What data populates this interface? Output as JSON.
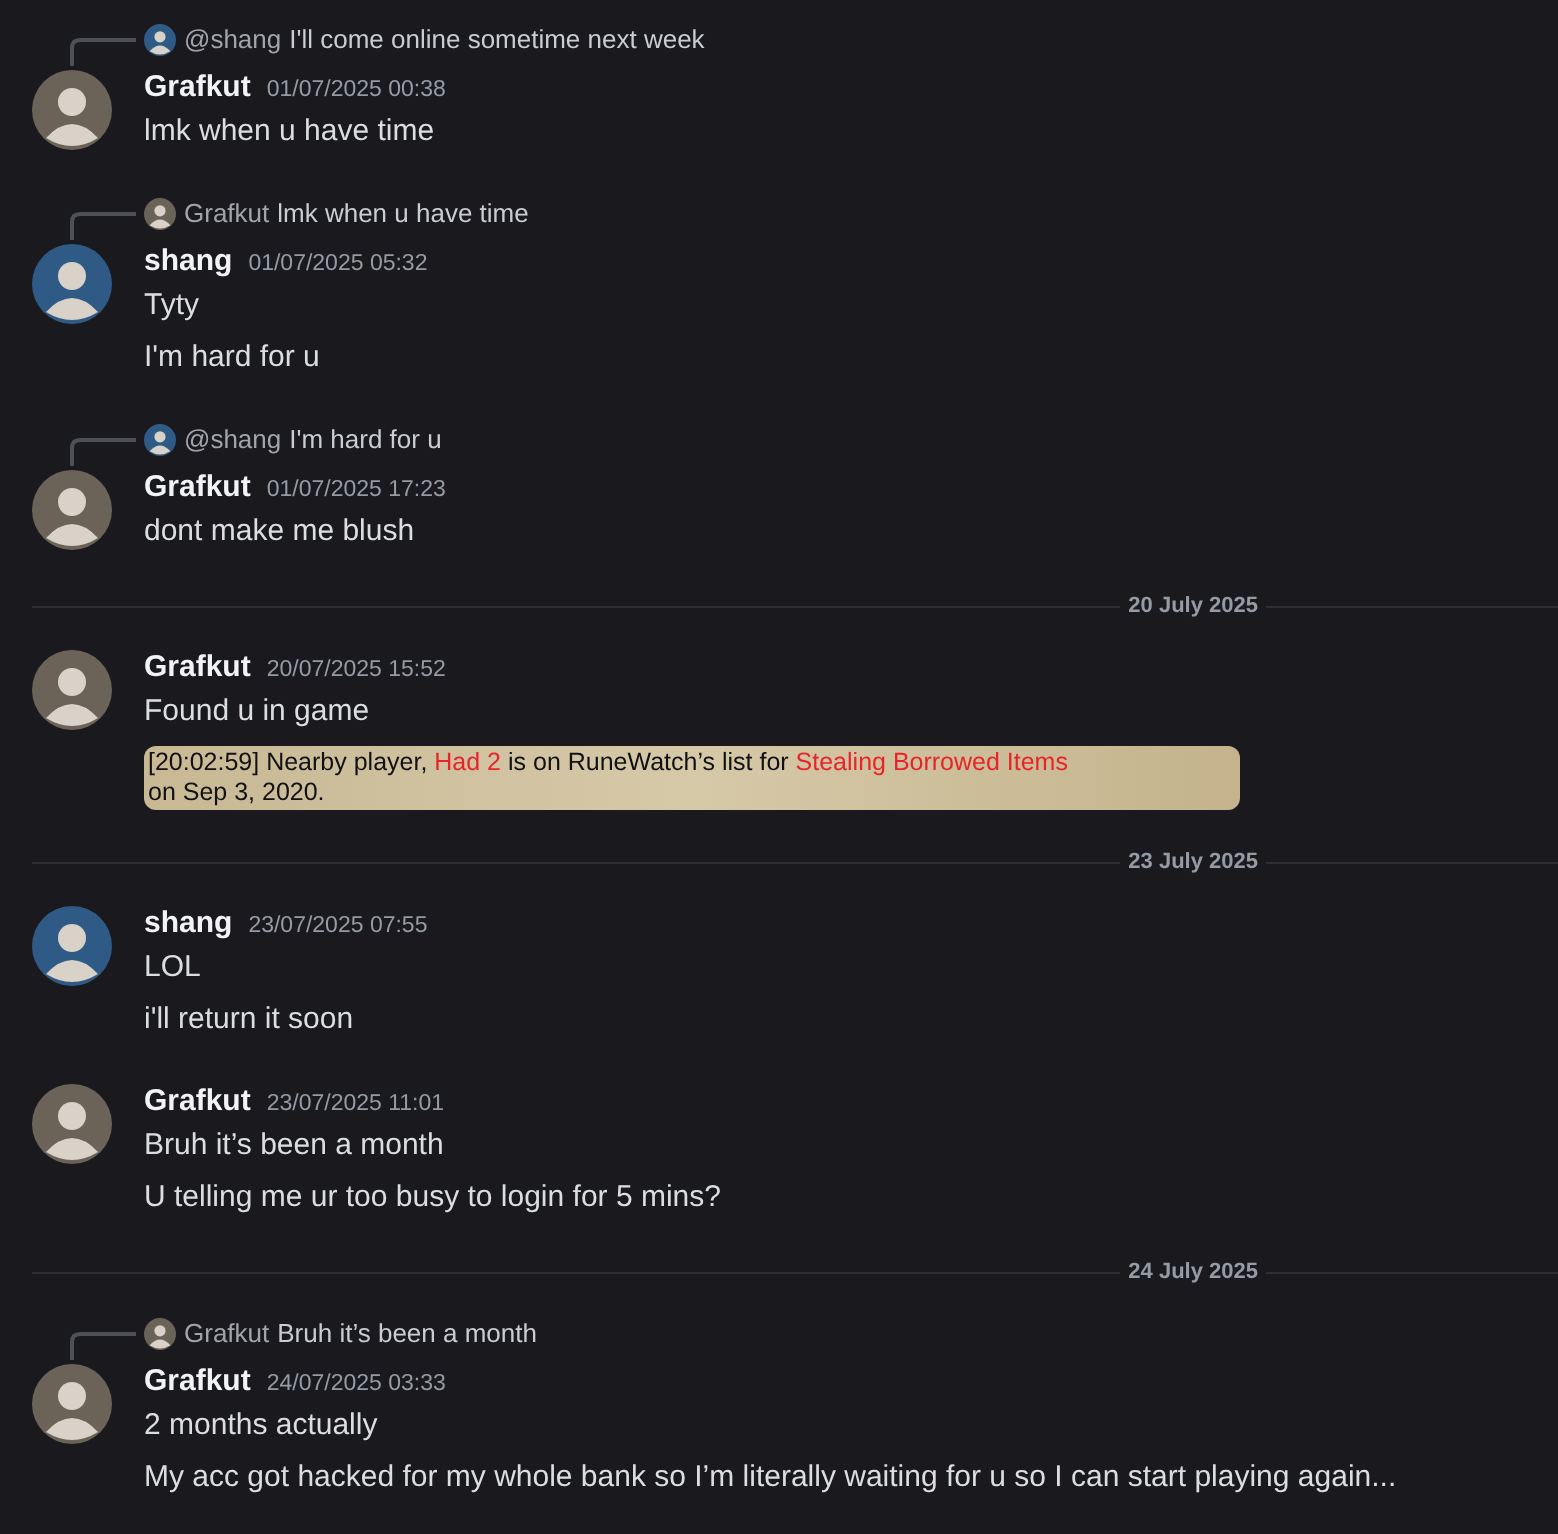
{
  "items": [
    {
      "kind": "message",
      "color": "#6b6358",
      "reply": {
        "color": "#2f5a86",
        "author": "@shang",
        "text": "I'll come online sometime next week"
      },
      "author": "Grafkut",
      "timestamp": "01/07/2025 00:38",
      "lines": [
        "lmk when u have time"
      ]
    },
    {
      "kind": "message",
      "color": "#2f5a86",
      "reply": {
        "color": "#6b6358",
        "author": "Grafkut",
        "text": "lmk when u have time"
      },
      "author": "shang",
      "timestamp": "01/07/2025 05:32",
      "lines": [
        "Tyty",
        "I'm hard for u"
      ]
    },
    {
      "kind": "message",
      "color": "#6b6358",
      "reply": {
        "color": "#2f5a86",
        "author": "@shang",
        "text": "I'm hard for u"
      },
      "author": "Grafkut",
      "timestamp": "01/07/2025 17:23",
      "lines": [
        "dont make me blush"
      ]
    },
    {
      "kind": "divider",
      "label": "20 July 2025"
    },
    {
      "kind": "message",
      "color": "#6b6358",
      "author": "Grafkut",
      "timestamp": "20/07/2025 15:52",
      "lines": [
        "Found u in game"
      ],
      "game_chat": [
        {
          "text": "[20:02:59] Nearby player, ",
          "highlight": false
        },
        {
          "text": "Had 2",
          "highlight": true
        },
        {
          "text": " is on RuneWatch’s list for ",
          "highlight": false
        },
        {
          "text": "Stealing Borrowed Items",
          "highlight": true
        },
        {
          "text": " on Sep 3, 2020.",
          "highlight": false
        }
      ]
    },
    {
      "kind": "divider",
      "label": "23 July 2025"
    },
    {
      "kind": "message",
      "color": "#2f5a86",
      "author": "shang",
      "timestamp": "23/07/2025 07:55",
      "lines": [
        "LOL",
        "i'll return it soon"
      ]
    },
    {
      "kind": "message",
      "color": "#6b6358",
      "author": "Grafkut",
      "timestamp": "23/07/2025 11:01",
      "lines": [
        "Bruh it’s been a month",
        "U telling me ur too busy to login for 5 mins?"
      ]
    },
    {
      "kind": "divider",
      "label": "24 July 2025"
    },
    {
      "kind": "message",
      "color": "#6b6358",
      "reply": {
        "color": "#6b6358",
        "author": "Grafkut",
        "text": "Bruh it’s been a month"
      },
      "author": "Grafkut",
      "timestamp": "24/07/2025 03:33",
      "lines": [
        "2 months actually",
        "My acc got hacked for my whole bank so I’m literally waiting for u so I can start playing again..."
      ]
    }
  ]
}
